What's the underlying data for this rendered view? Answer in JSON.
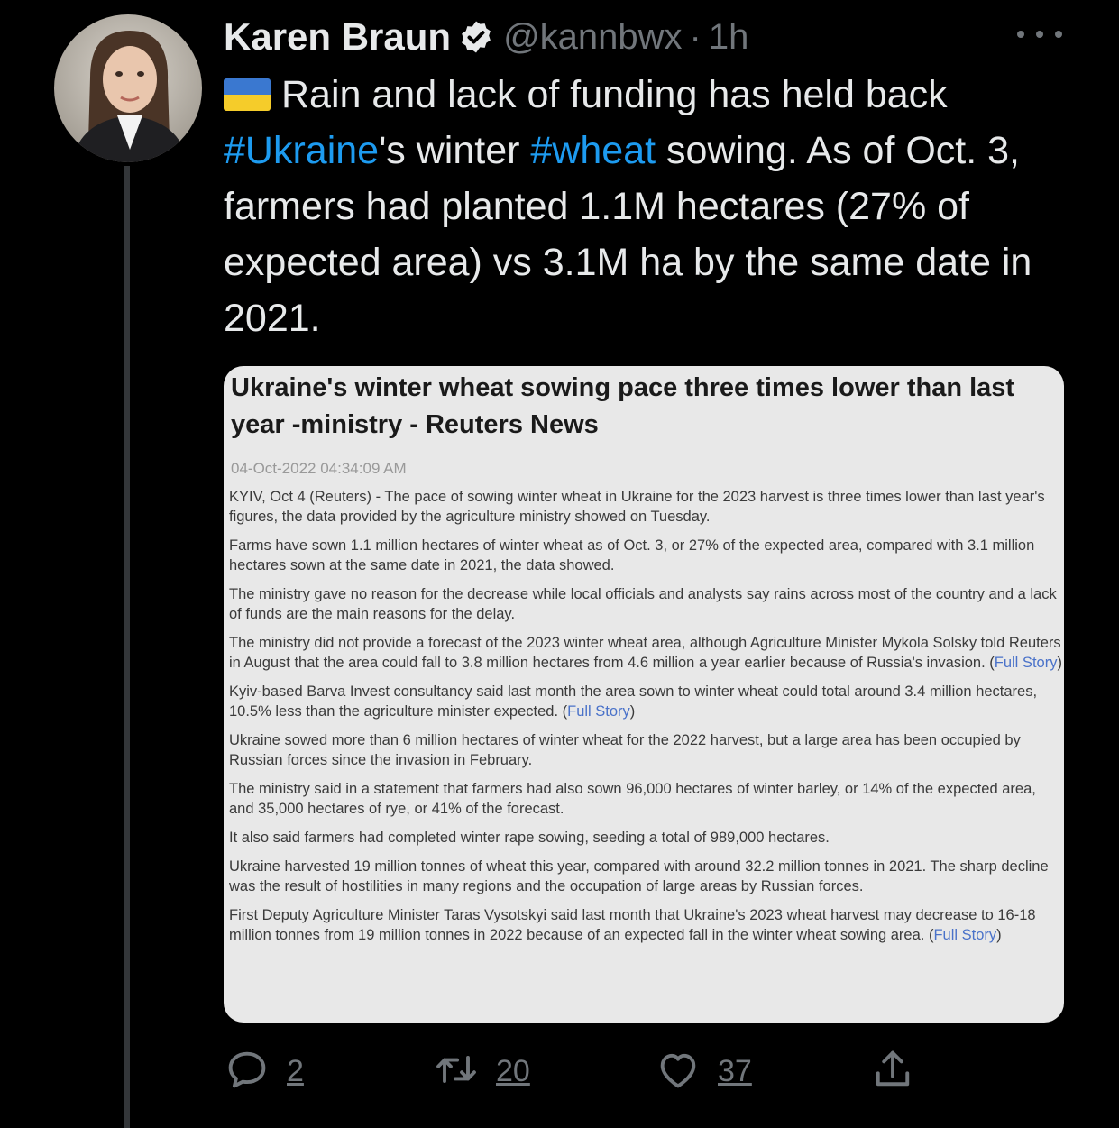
{
  "author": {
    "name": "Karen Braun",
    "handle": "@kannbwx",
    "separator": "·",
    "time": "1h"
  },
  "tweet": {
    "segments": [
      {
        "text": "Rain and lack of funding has held back "
      },
      {
        "text": "#Ukraine",
        "hashtag": true
      },
      {
        "text": "'s winter "
      },
      {
        "text": "#wheat",
        "hashtag": true
      },
      {
        "text": " sowing. As of Oct. 3, farmers had planted 1.1M hectares (27% of expected area) vs 3.1M ha by the same date in 2021."
      }
    ]
  },
  "article": {
    "title": "Ukraine's winter wheat sowing pace three times lower than last year -ministry - Reuters News",
    "date": "04-Oct-2022 04:34:09 AM",
    "paragraphs": [
      {
        "text": "KYIV, Oct 4 (Reuters) - The pace of sowing winter wheat in Ukraine for the 2023 harvest is three times lower than last year's figures, the data provided by the agriculture ministry showed on Tuesday.",
        "link": ""
      },
      {
        "text": "Farms have sown 1.1 million hectares of winter wheat as of Oct. 3, or 27% of the expected area, compared with 3.1 million hectares sown at the same date in 2021, the data showed.",
        "link": ""
      },
      {
        "text": "The ministry gave no reason for the decrease while local officials and analysts say rains across most of the country and a lack of funds are the main reasons for the delay.",
        "link": ""
      },
      {
        "text": "The ministry did not provide a forecast of the 2023 winter wheat area, although Agriculture Minister Mykola Solsky told Reuters in August that the area could fall to 3.8 million hectares from 4.6 million a year earlier because of Russia's invasion. (",
        "link": "Full Story",
        "after": ")"
      },
      {
        "text": "Kyiv-based Barva Invest consultancy said last month the area sown to winter wheat could total around 3.4 million hectares, 10.5% less than the agriculture minister expected. (",
        "link": "Full Story",
        "after": ")"
      },
      {
        "text": "Ukraine sowed more than 6 million hectares of winter wheat for the 2022 harvest, but a large area has been occupied by Russian forces since the invasion in February.",
        "link": ""
      },
      {
        "text": "The ministry said in a statement that farmers had also sown 96,000 hectares of winter barley, or 14% of the expected area, and 35,000 hectares of rye, or 41% of the forecast.",
        "link": ""
      },
      {
        "text": "It also said farmers had completed winter rape sowing, seeding a total of 989,000 hectares.",
        "link": ""
      },
      {
        "text": "Ukraine harvested 19 million tonnes of wheat this year, compared with around 32.2 million tonnes in 2021. The sharp decline was the result of hostilities in many regions and the occupation of large areas by Russian forces.",
        "link": ""
      },
      {
        "text": "First Deputy Agriculture Minister Taras Vysotskyi said last month that Ukraine's 2023 wheat harvest may decrease to 16-18 million tonnes from 19 million tonnes in 2022 because of an expected fall in the winter wheat sowing area. (",
        "link": "Full Story",
        "after": ")"
      }
    ]
  },
  "actions": {
    "replies": "2",
    "retweets": "20",
    "likes": "37"
  },
  "icons": [
    "verified-badge-icon",
    "more-options-icon",
    "ukraine-flag-icon",
    "reply-icon",
    "retweet-icon",
    "like-icon",
    "share-icon"
  ],
  "colors": {
    "background": "#000000",
    "text": "#e7e9ea",
    "muted": "#71767b",
    "hashtag": "#1d9bf0",
    "article_link": "#4a72c9"
  }
}
